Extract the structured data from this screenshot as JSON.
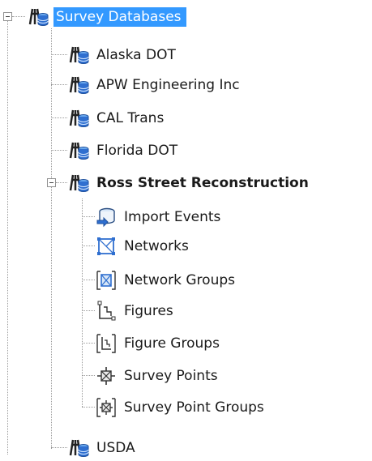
{
  "tree": {
    "root": {
      "label": "Survey Databases",
      "icon": "survey-database-icon",
      "expanded": true,
      "selected": true
    },
    "databases": [
      {
        "label": "Alaska DOT",
        "icon": "survey-database-icon"
      },
      {
        "label": "APW Engineering Inc",
        "icon": "survey-database-icon"
      },
      {
        "label": "CAL Trans",
        "icon": "survey-database-icon"
      },
      {
        "label": "Florida DOT",
        "icon": "survey-database-icon"
      },
      {
        "label": "Ross Street Reconstruction",
        "icon": "survey-database-icon",
        "expanded": true,
        "bold": true
      },
      {
        "label": "USDA",
        "icon": "survey-database-icon"
      }
    ],
    "children": [
      {
        "label": "Import Events",
        "icon": "import-events-icon"
      },
      {
        "label": "Networks",
        "icon": "networks-icon"
      },
      {
        "label": "Network Groups",
        "icon": "network-groups-icon"
      },
      {
        "label": "Figures",
        "icon": "figures-icon"
      },
      {
        "label": "Figure Groups",
        "icon": "figure-groups-icon"
      },
      {
        "label": "Survey Points",
        "icon": "survey-points-icon"
      },
      {
        "label": "Survey Point Groups",
        "icon": "survey-point-groups-icon"
      }
    ],
    "colors": {
      "selection": "#3399ff",
      "icon_blue": "#2f6fd0",
      "icon_dark": "#222222"
    }
  }
}
